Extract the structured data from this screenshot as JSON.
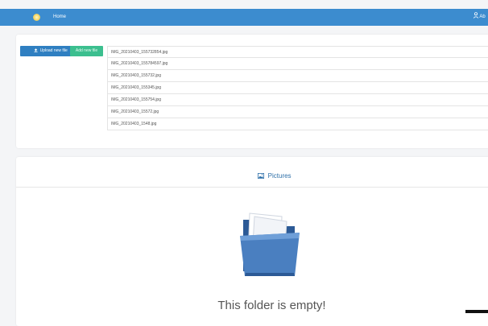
{
  "topbar": {
    "home_label": "Home",
    "user_label": "Ab"
  },
  "toolbar": {
    "upload_label": "Upload new file",
    "add_label": "Add new file"
  },
  "files": [
    "IMG_20210403_155732854.jpg",
    "IMG_20210403_155784597.jpg",
    "IMG_20210403_155732.jpg",
    "IMG_20210403_155345.jpg",
    "IMG_20210403_155754.jpg",
    "IMG_20210403_15572.jpg",
    "IMG_20210403_1548.jpg"
  ],
  "folder_view": {
    "tab_label": "Pictures",
    "empty_message": "This folder is empty!"
  },
  "icons": {
    "logo": "sun-logo-icon",
    "user": "user-icon",
    "upload": "upload-icon",
    "tab": "image-icon",
    "folder": "open-folder-icon"
  },
  "colors": {
    "topbar": "#3c8ccf",
    "upload_button": "#2f7fc1",
    "add_button": "#3cbf8f",
    "folder": "#4a7fc0"
  }
}
